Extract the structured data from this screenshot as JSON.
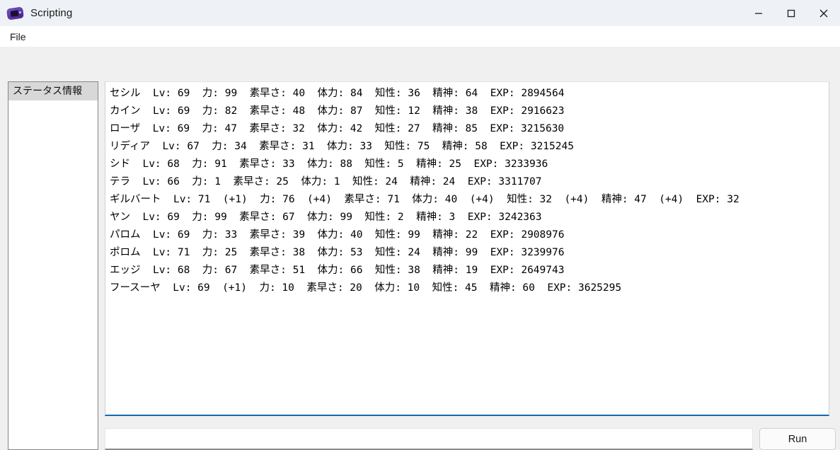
{
  "window": {
    "title": "Scripting",
    "icon": "gameboy-icon",
    "controls": {
      "minimize": "minimize-icon",
      "maximize": "maximize-icon",
      "close": "close-icon"
    }
  },
  "menubar": {
    "items": [
      {
        "label": "File"
      }
    ]
  },
  "sidebar": {
    "items": [
      {
        "label": "ステータス情報",
        "selected": true
      }
    ]
  },
  "output": {
    "lines": [
      "セシル  Lv: 69  力: 99  素早さ: 40  体力: 84  知性: 36  精神: 64  EXP: 2894564",
      "カイン  Lv: 69  力: 82  素早さ: 48  体力: 87  知性: 12  精神: 38  EXP: 2916623",
      "ローザ  Lv: 69  力: 47  素早さ: 32  体力: 42  知性: 27  精神: 85  EXP: 3215630",
      "リディア  Lv: 67  力: 34  素早さ: 31  体力: 33  知性: 75  精神: 58  EXP: 3215245",
      "シド  Lv: 68  力: 91  素早さ: 33  体力: 88  知性: 5  精神: 25  EXP: 3233936",
      "テラ  Lv: 66  力: 1  素早さ: 25  体力: 1  知性: 24  精神: 24  EXP: 3311707",
      "ギルバート  Lv: 71  (+1)  力: 76  (+4)  素早さ: 71  体力: 40  (+4)  知性: 32  (+4)  精神: 47  (+4)  EXP: 32",
      "ヤン  Lv: 69  力: 99  素早さ: 67  体力: 99  知性: 2  精神: 3  EXP: 3242363",
      "パロム  Lv: 69  力: 33  素早さ: 39  体力: 40  知性: 99  精神: 22  EXP: 2908976",
      "ポロム  Lv: 71  力: 25  素早さ: 38  体力: 53  知性: 24  精神: 99  EXP: 3239976",
      "エッジ  Lv: 68  力: 67  素早さ: 51  体力: 66  知性: 38  精神: 19  EXP: 2649743",
      "フースーヤ  Lv: 69  (+1)  力: 10  素早さ: 20  体力: 10  知性: 45  精神: 60  EXP: 3625295"
    ],
    "text": ""
  },
  "command": {
    "value": "",
    "placeholder": ""
  },
  "actions": {
    "run_label": "Run"
  },
  "colors": {
    "titlebar_bg": "#eef2f6",
    "accent_focus": "#1767b0",
    "selection_bg": "#d8d8d8",
    "app_bg": "#f0f0f0"
  }
}
